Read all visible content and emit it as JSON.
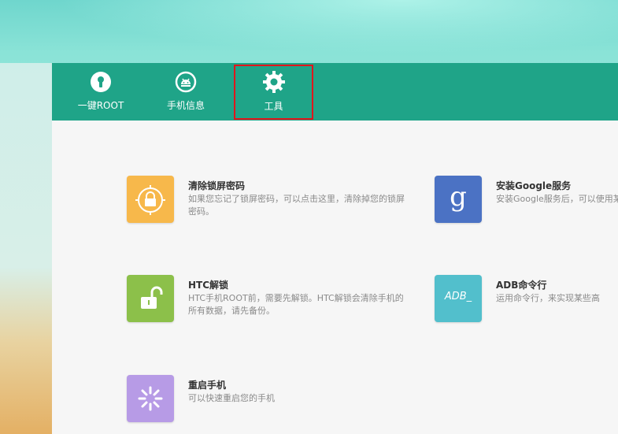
{
  "nav": {
    "tabs": [
      {
        "label": "一键ROOT",
        "icon": "key-icon"
      },
      {
        "label": "手机信息",
        "icon": "android-icon"
      },
      {
        "label": "工具",
        "icon": "gear-icon",
        "selected": true
      }
    ]
  },
  "tools": [
    {
      "title": "清除锁屏密码",
      "desc": "如果您忘记了锁屏密码，可以点击这里，清除掉您的锁屏密码。",
      "icon": "lock-icon",
      "color": "#f7b84b"
    },
    {
      "title": "安装Google服务",
      "desc": "安装Google服务后，可以使用某些大型游戏。",
      "icon": "google-g-icon",
      "icon_text": "g",
      "color": "#4b72c4"
    },
    {
      "title": "HTC解锁",
      "desc": "HTC手机ROOT前，需要先解锁。HTC解锁会清除手机的所有数据，请先备份。",
      "icon": "unlock-icon",
      "color": "#8cc04a"
    },
    {
      "title": "ADB命令行",
      "desc": "运用命令行，来实现某些高",
      "icon": "terminal-icon",
      "icon_text": "ADB_",
      "color": "#52bfcc"
    },
    {
      "title": "重启手机",
      "desc": "可以快速重启您的手机",
      "icon": "restart-icon",
      "color": "#b79be6"
    }
  ],
  "colors": {
    "topbar": "#1fa488",
    "selected_border": "#e0161b"
  }
}
